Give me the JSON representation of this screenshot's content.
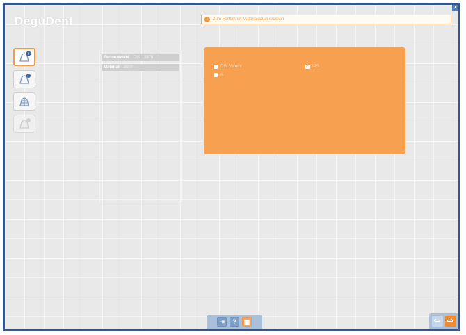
{
  "app": {
    "title": "DeguDent"
  },
  "alert": {
    "text": "Zum Fortfahren Materialdaten drucken"
  },
  "side_panel": {
    "rows": [
      {
        "label": "Farbauswahl",
        "value": "DIN 13970"
      },
      {
        "label": "Material",
        "value": "2500"
      }
    ]
  },
  "options": [
    {
      "label": "DIN Vereint",
      "checked": false
    },
    {
      "label": "IPS",
      "checked": true
    },
    {
      "label": "K",
      "checked": false
    }
  ],
  "bottom_bar": {
    "help": "?",
    "grid": "▦",
    "cursor": "⇥"
  },
  "nav": {
    "back": "⇦",
    "next": "⇨"
  },
  "colors": {
    "accent": "#f7a04f",
    "frame": "#34568a",
    "nav": "#a9c0db"
  }
}
